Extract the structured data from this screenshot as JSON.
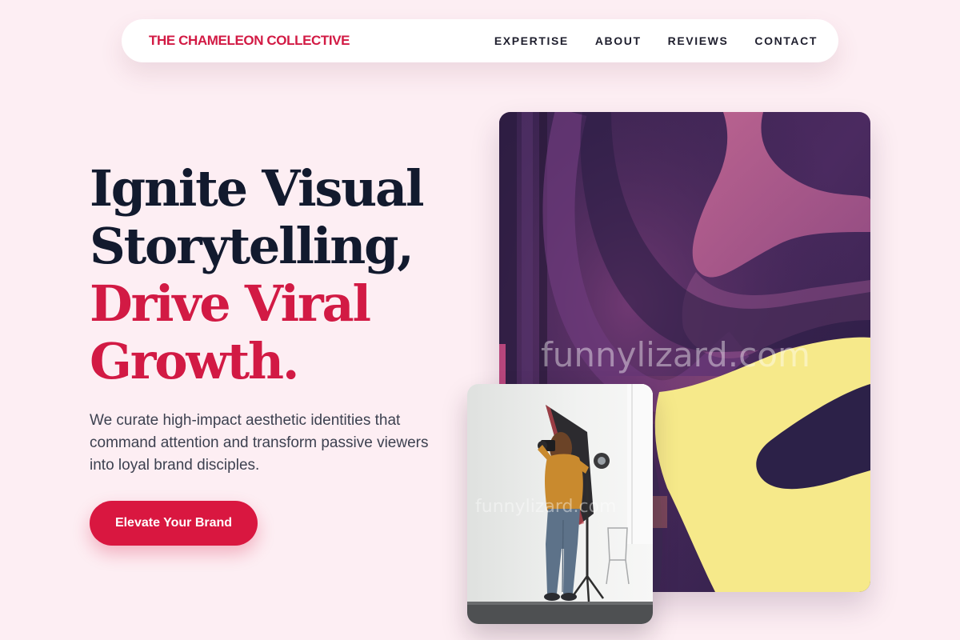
{
  "nav": {
    "brand": "THE CHAMELEON COLLECTIVE",
    "links": [
      "EXPERTISE",
      "ABOUT",
      "REVIEWS",
      "CONTACT"
    ]
  },
  "hero": {
    "headline_dark": [
      "Ignite Visual",
      "Storytelling,"
    ],
    "headline_accent": [
      "Drive Viral",
      "Growth."
    ],
    "subtext": "We curate high-impact aesthetic identities that command attention and transform passive viewers into loyal brand disciples.",
    "cta_label": "Elevate Your Brand"
  },
  "images": {
    "art_watermark": "funnylizard.com",
    "photo_watermark": "funnylizard.com"
  },
  "colors": {
    "accent": "#d21a44",
    "background": "#fdeef3",
    "heading": "#121a2e"
  }
}
